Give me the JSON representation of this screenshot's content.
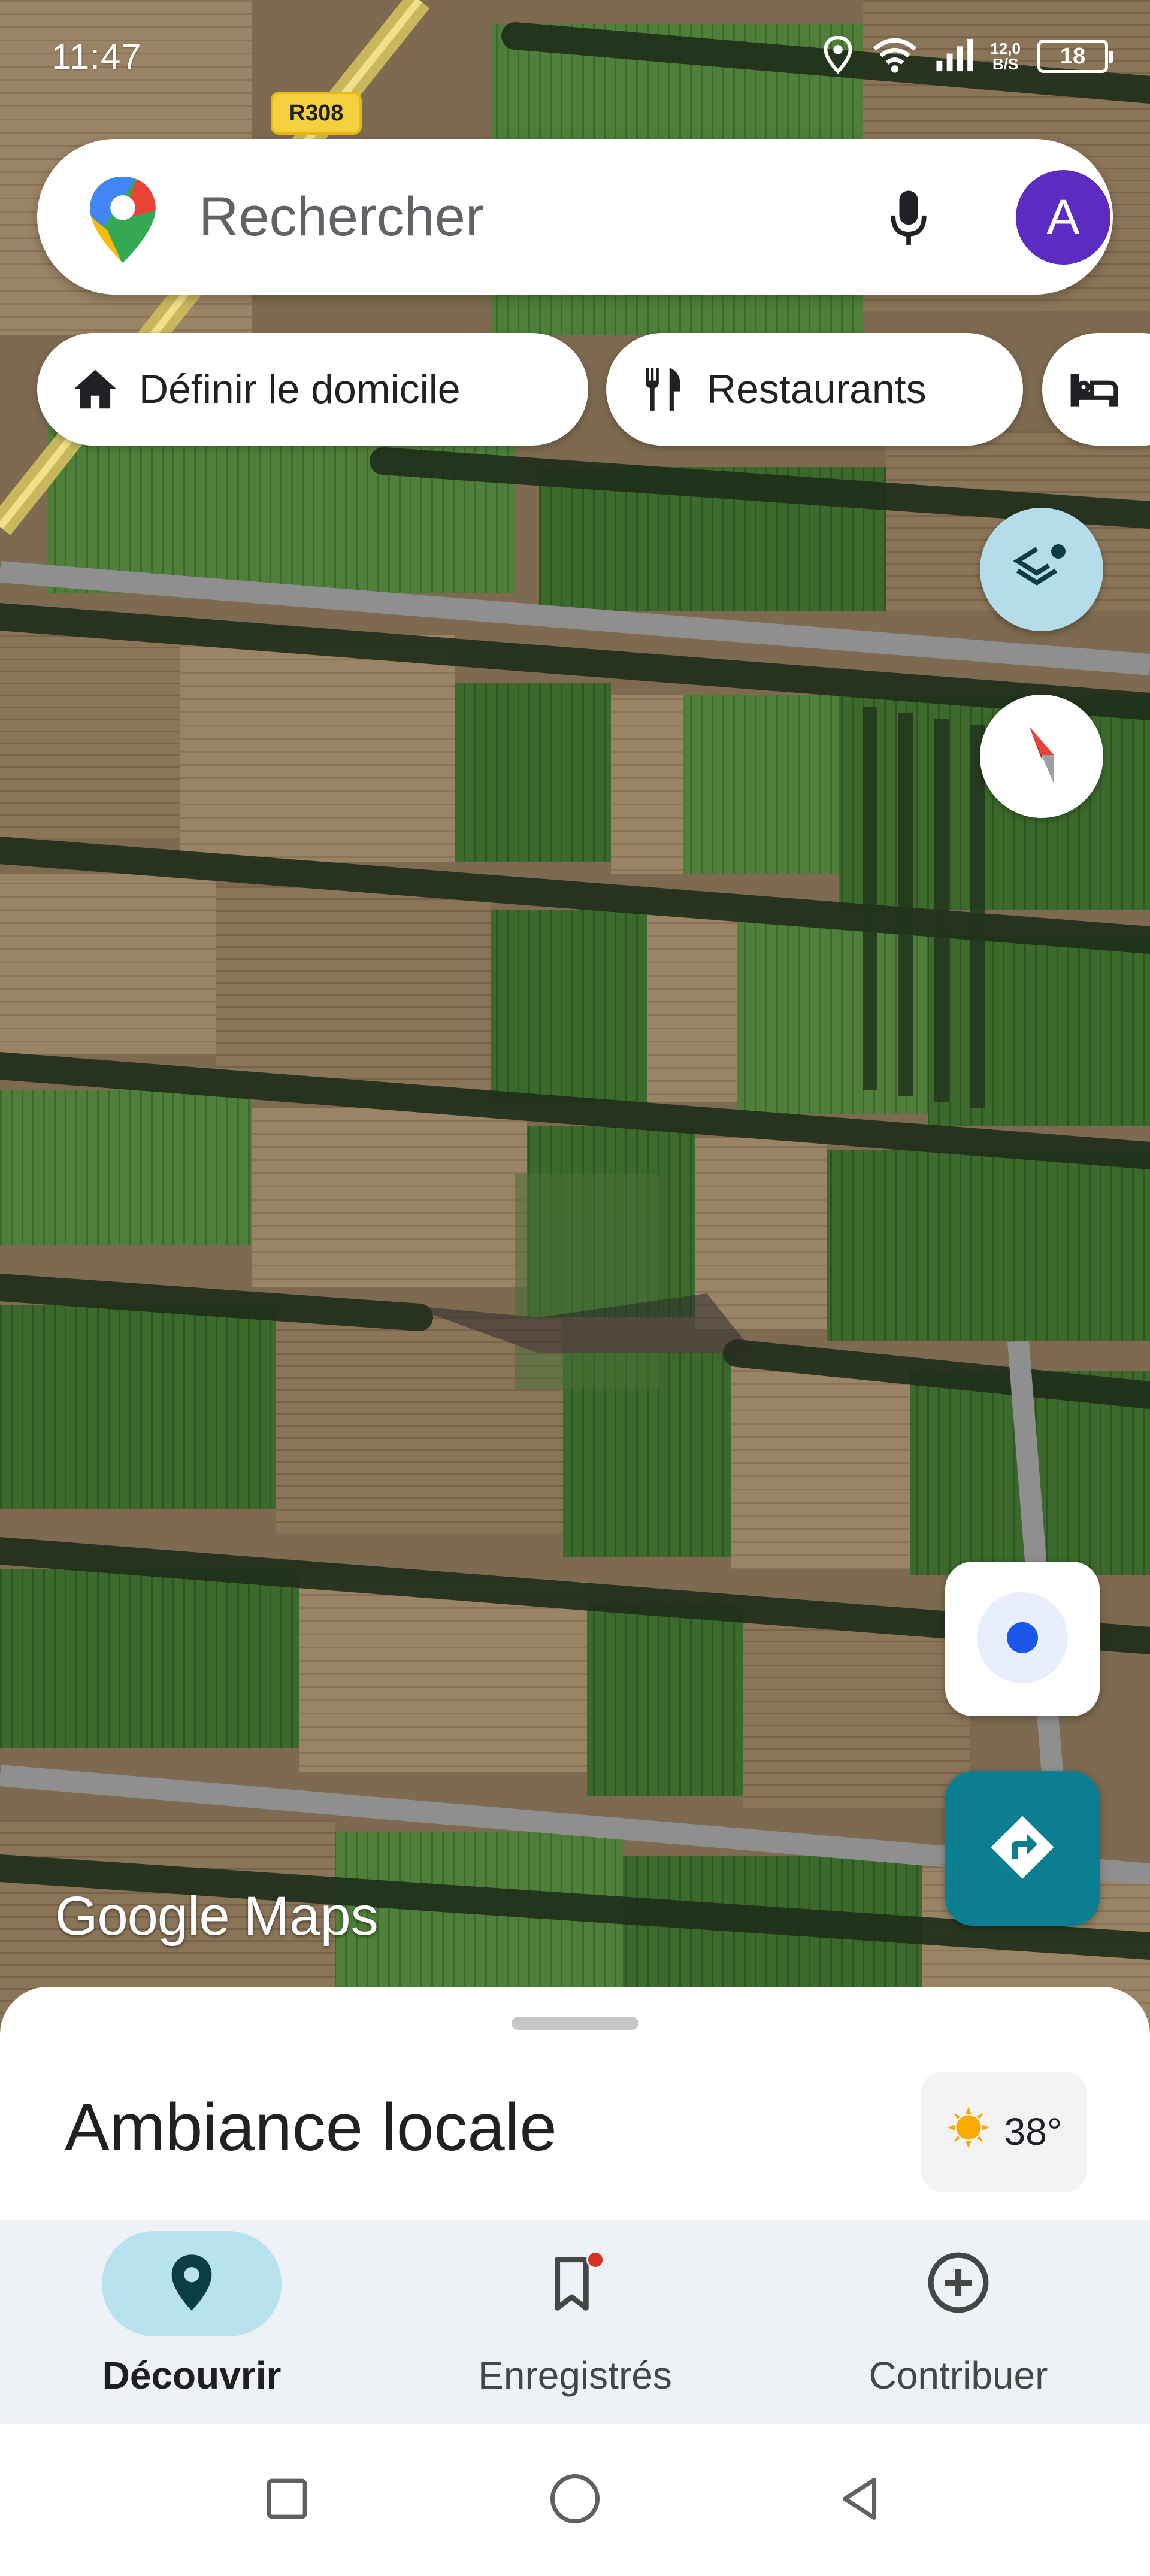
{
  "status_bar": {
    "time": "11:47",
    "net_speed_value": "12,0",
    "net_speed_unit": "B/S",
    "battery": "18"
  },
  "map": {
    "road_label": "R308",
    "attribution_google": "Google",
    "attribution_maps": "Maps"
  },
  "search": {
    "placeholder": "Rechercher",
    "avatar_letter": "A"
  },
  "chips": [
    {
      "label": "Définir le domicile",
      "icon": "home-icon"
    },
    {
      "label": "Restaurants",
      "icon": "restaurant-icon"
    },
    {
      "label": "",
      "icon": "hotel-icon"
    }
  ],
  "sheet": {
    "title": "Ambiance locale",
    "weather": "38°"
  },
  "bottom_nav": [
    {
      "label": "Découvrir",
      "icon": "explore-pin-icon",
      "active": true
    },
    {
      "label": "Enregistrés",
      "icon": "bookmark-icon",
      "active": false
    },
    {
      "label": "Contribuer",
      "icon": "add-circle-icon",
      "active": false
    }
  ],
  "colors": {
    "accent_teal": "#0b7f91",
    "avatar_purple": "#5b2bc2",
    "active_pill": "#b7e2ee",
    "location_dot": "#1a56e8",
    "notification_dot": "#d93025"
  }
}
